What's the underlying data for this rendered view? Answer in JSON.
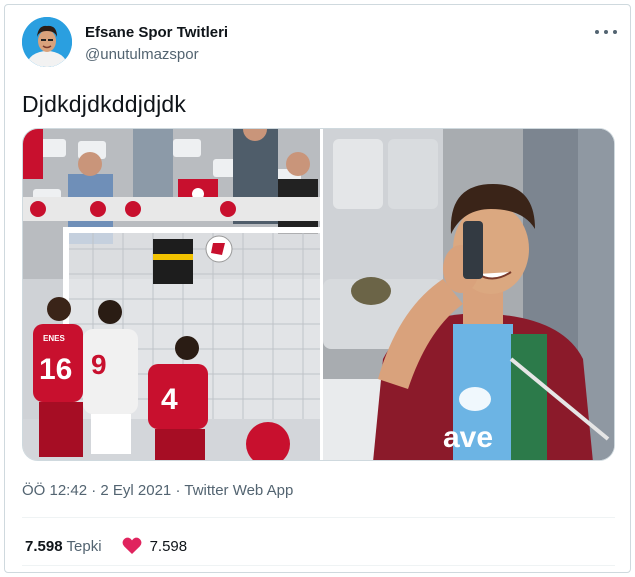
{
  "author": {
    "name": "Efsane Spor Twitleri",
    "handle": "@unutulmazspor"
  },
  "tweet": {
    "text": "Djdkdjdkddjdjdk"
  },
  "media": {
    "left_image": {
      "jersey_numbers": [
        "16",
        "9",
        "4"
      ],
      "jersey_names": [
        "ENES"
      ]
    },
    "right_image": {
      "shirt_text": "ave"
    }
  },
  "meta": {
    "time": "ÖÖ 12:42",
    "separator1": "·",
    "date": "2 Eyl 2021",
    "separator2": "·",
    "source": "Twitter Web App"
  },
  "stats": {
    "reactions_count": "7.598",
    "reactions_label": "Tepki",
    "likes_count": "7.598"
  },
  "colors": {
    "heart": "#e0245e",
    "turkey_red": "#c8102e",
    "trabzon_claret": "#8b1a2a",
    "trabzon_blue": "#6cb4e4"
  }
}
